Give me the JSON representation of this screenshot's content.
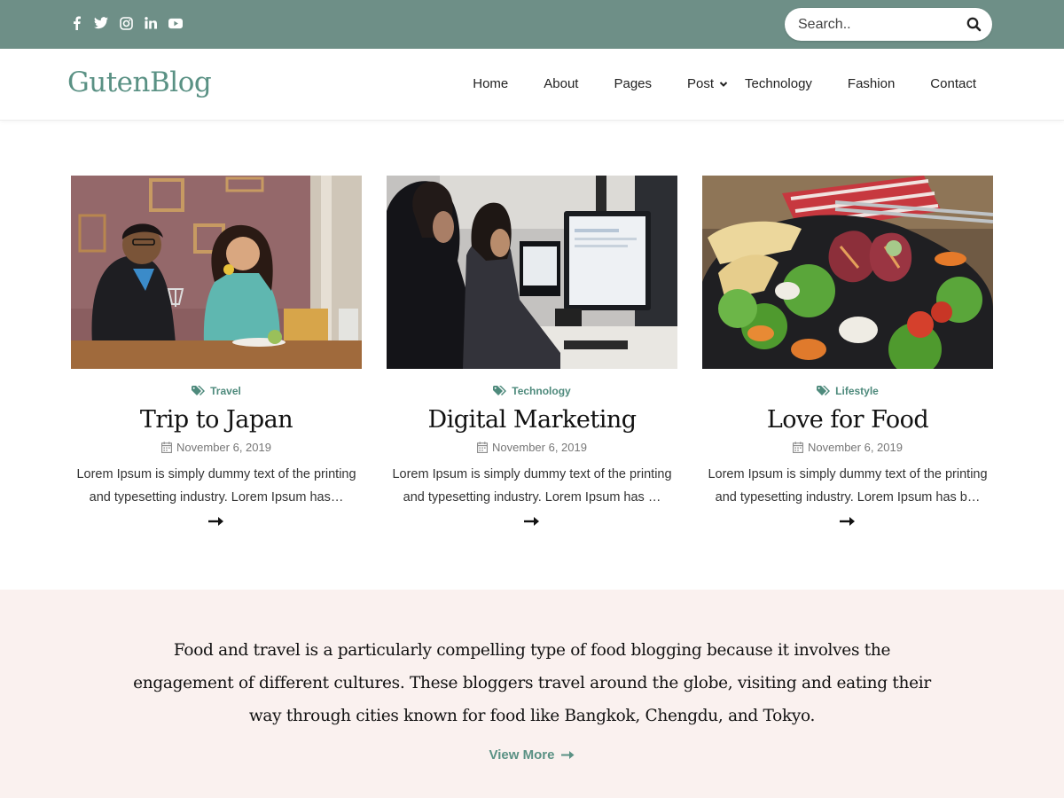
{
  "colors": {
    "topbar": "#6e8f87",
    "accent": "#4e8a7c",
    "logo": "#5a9184",
    "band": "#faf1ef"
  },
  "topbar": {
    "social_icons": [
      "facebook-icon",
      "twitter-icon",
      "instagram-icon",
      "linkedin-icon",
      "youtube-icon"
    ],
    "search": {
      "placeholder": "Search.."
    }
  },
  "header": {
    "logo": "GutenBlog",
    "nav": [
      {
        "label": "Home"
      },
      {
        "label": "About"
      },
      {
        "label": "Pages"
      },
      {
        "label": "Post",
        "has_dropdown": true
      },
      {
        "label": "Technology"
      },
      {
        "label": "Fashion"
      },
      {
        "label": "Contact"
      }
    ]
  },
  "posts": [
    {
      "category": "Travel",
      "title": "Trip to Japan",
      "date": "November 6, 2019",
      "excerpt": "Lorem Ipsum is simply dummy text of the printing and typesetting industry. Lorem Ipsum has…"
    },
    {
      "category": "Technology",
      "title": "Digital Marketing",
      "date": "November 6, 2019",
      "excerpt": "Lorem Ipsum is simply dummy text of the printing and typesetting industry. Lorem Ipsum has …"
    },
    {
      "category": "Lifestyle",
      "title": "Love for Food",
      "date": "November 6, 2019",
      "excerpt": "Lorem Ipsum is simply dummy text of the printing and typesetting industry. Lorem Ipsum has b…"
    }
  ],
  "feature": {
    "text": "Food and travel is a particularly compelling type of food blogging because it involves the engagement of different cultures. These bloggers travel around the globe, visiting and eating their way through cities known for food like Bangkok, Chengdu, and Tokyo.",
    "link": "View More"
  }
}
